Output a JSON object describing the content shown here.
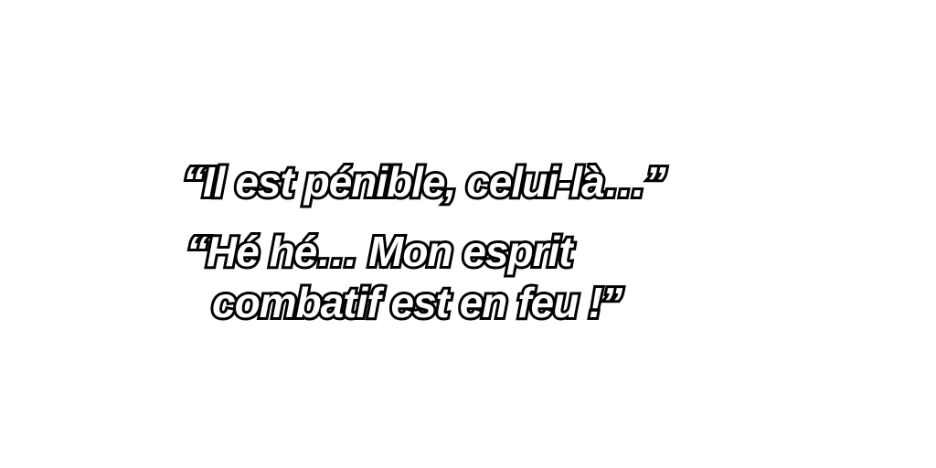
{
  "captions": [
    "“Il est pénible, celui-là…”",
    "“Hé hé… Mon esprit",
    "combatif est en feu !”"
  ]
}
